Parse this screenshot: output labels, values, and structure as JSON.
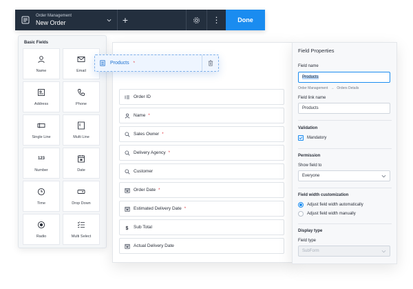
{
  "topbar": {
    "breadcrumb": "Order Management",
    "form_title": "New Order",
    "add_symbol": "+",
    "more_symbol": "⋮",
    "done_label": "Done"
  },
  "palette": {
    "title": "Basic Fields",
    "items": [
      {
        "label": "Name",
        "icon": "person-icon"
      },
      {
        "label": "Email",
        "icon": "envelope-icon"
      },
      {
        "label": "Address",
        "icon": "address-card-icon"
      },
      {
        "label": "Phone",
        "icon": "phone-icon"
      },
      {
        "label": "Single Line",
        "icon": "single-line-icon"
      },
      {
        "label": "Multi Line",
        "icon": "multi-line-icon"
      },
      {
        "label": "Number",
        "icon": "number-icon",
        "glyph": "123"
      },
      {
        "label": "Date",
        "icon": "calendar-icon"
      },
      {
        "label": "Time",
        "icon": "clock-icon"
      },
      {
        "label": "Drop Down",
        "icon": "dropdown-icon"
      },
      {
        "label": "Radio",
        "icon": "radio-icon"
      },
      {
        "label": "Multi Select",
        "icon": "checklist-icon"
      }
    ]
  },
  "drag_ghost": {
    "label": "Products",
    "required_mark": "*"
  },
  "form_fields": [
    {
      "label": "Order ID",
      "icon": "id-icon",
      "required": false
    },
    {
      "label": "Name",
      "icon": "person-icon",
      "required": true
    },
    {
      "label": "Sales Owner",
      "icon": "lookup-icon",
      "required": true
    },
    {
      "label": "Delivery Agency",
      "icon": "lookup-icon",
      "required": true
    },
    {
      "label": "Customer",
      "icon": "lookup-icon",
      "required": false
    },
    {
      "label": "Order Date",
      "icon": "calendar-icon",
      "required": true
    },
    {
      "label": "Estimated Delivery Date",
      "icon": "calendar-icon",
      "required": true
    },
    {
      "label": "Sub Total",
      "icon": "currency-icon",
      "required": false
    },
    {
      "label": "Actual Delivery Date",
      "icon": "calendar-icon",
      "required": false
    }
  ],
  "required_mark": "*",
  "properties": {
    "title": "Field Properties",
    "field_name_label": "Field name",
    "field_name_value": "Products",
    "crumb_app": "Order Management",
    "crumb_arrow": "→",
    "crumb_form": "Orders Details",
    "field_link_label": "Field link name",
    "field_link_value": "Products",
    "validation_title": "Validation",
    "mandatory_label": "Mandatory",
    "permission_title": "Permission",
    "show_field_label": "Show field to",
    "show_field_value": "Everyone",
    "width_title": "Field width customization",
    "width_auto_label": "Adjust field width automatically",
    "width_manual_label": "Adjust field width manually",
    "display_type_title": "Display type",
    "field_type_label": "Field type",
    "field_type_value": "SubForm"
  },
  "colors": {
    "topbar": "#232f3e",
    "accent": "#1a8cf0",
    "required": "#e0303a"
  }
}
